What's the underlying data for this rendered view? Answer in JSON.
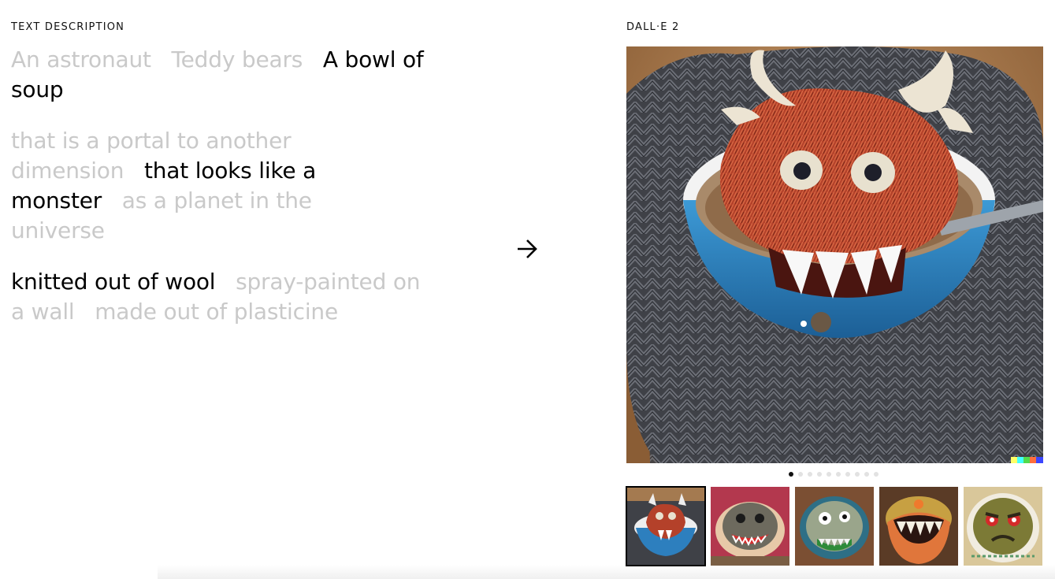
{
  "left_label": "TEXT DESCRIPTION",
  "right_label": "DALL·E 2",
  "prompt_groups": [
    {
      "options": [
        {
          "label": "An astronaut",
          "selected": false
        },
        {
          "label": "Teddy bears",
          "selected": false
        },
        {
          "label": "A bowl of soup",
          "selected": true
        }
      ]
    },
    {
      "options": [
        {
          "label": "that is a portal to another dimension",
          "selected": false
        },
        {
          "label": "that looks like a monster",
          "selected": true
        },
        {
          "label": "as a planet in the universe",
          "selected": false
        }
      ]
    },
    {
      "options": [
        {
          "label": "knitted out of wool",
          "selected": true
        },
        {
          "label": "spray-painted on a wall",
          "selected": false
        },
        {
          "label": "made out of plasticine",
          "selected": false
        }
      ]
    }
  ],
  "arrow_icon": "arrow-right-icon",
  "carousel": {
    "total": 10,
    "active": 0
  },
  "thumbnails": [
    {
      "name": "thumbnail-1",
      "active": true
    },
    {
      "name": "thumbnail-2",
      "active": false
    },
    {
      "name": "thumbnail-3",
      "active": false
    },
    {
      "name": "thumbnail-4",
      "active": false
    },
    {
      "name": "thumbnail-5",
      "active": false
    }
  ]
}
